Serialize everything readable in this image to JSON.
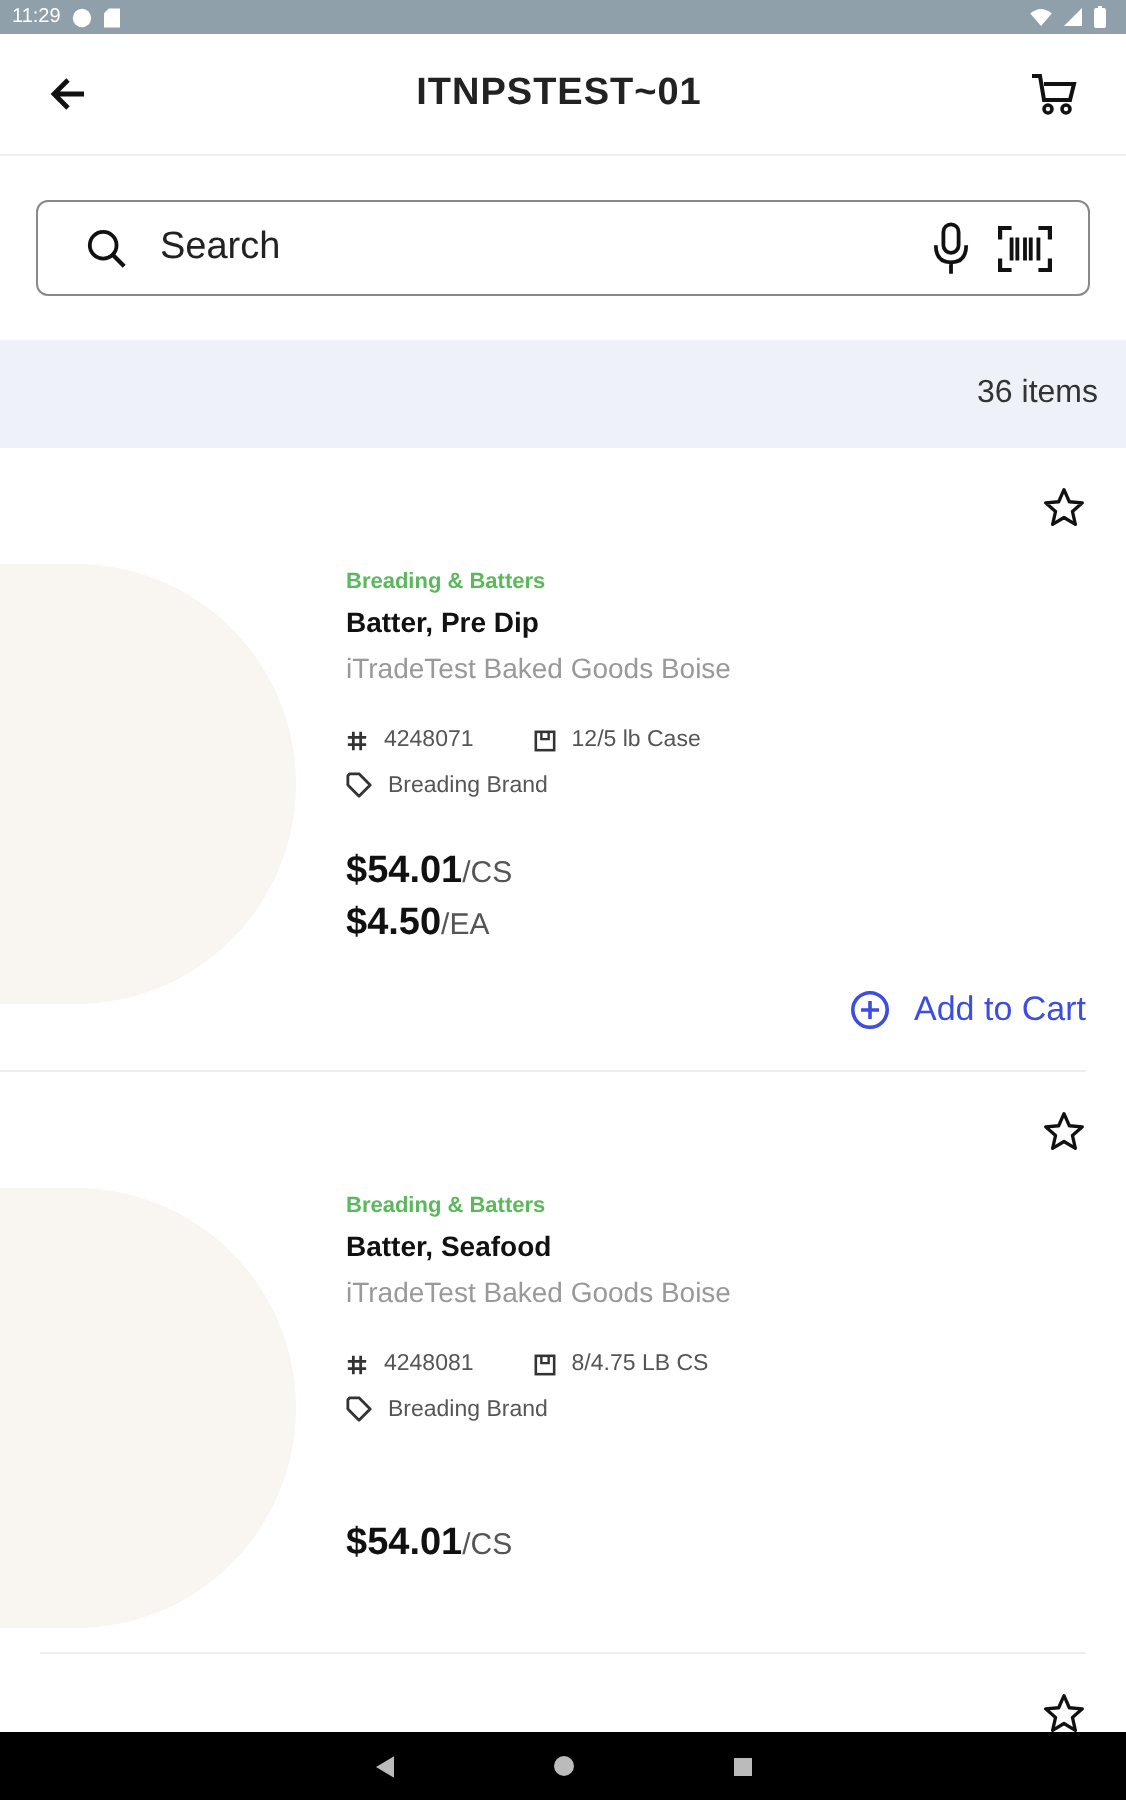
{
  "status_bar": {
    "time": "11:29"
  },
  "header": {
    "title": "ITNPSTEST~01"
  },
  "search": {
    "placeholder": "Search"
  },
  "results": {
    "count": "36 items"
  },
  "items": [
    {
      "favorite": false,
      "category": "Breading & Batters",
      "name": "Batter, Pre Dip",
      "supplier": "iTradeTest Baked Goods Boise",
      "code": "4248071",
      "pack": "12/5 lb Case",
      "brand": "Breading Brand",
      "prices": [
        {
          "amount": "$54.01",
          "unit": "/CS"
        },
        {
          "amount": "$4.50",
          "unit": "/EA"
        }
      ],
      "action": "Add to Cart"
    },
    {
      "favorite": false,
      "category": "Breading & Batters",
      "name": "Batter, Seafood",
      "supplier": "iTradeTest Baked Goods Boise",
      "code": "4248081",
      "pack": "8/4.75 LB CS",
      "brand": "Breading Brand",
      "prices": [
        {
          "amount": "$54.01",
          "unit": "/CS"
        }
      ]
    },
    {
      "favorite": false
    }
  ]
}
